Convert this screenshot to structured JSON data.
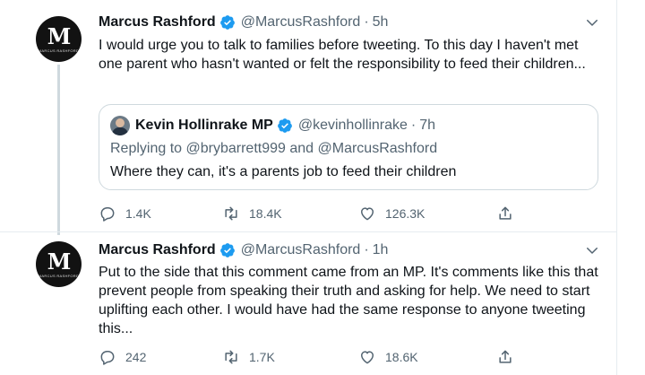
{
  "tweets": [
    {
      "author": {
        "name": "Marcus Rashford",
        "handle": "@MarcusRashford",
        "avatar_mark": "M",
        "avatar_caption": "MARCUS RASHFORD"
      },
      "time": "5h",
      "dot": "·",
      "text": "I would urge you to talk to families before tweeting. To this day I haven't met one parent who hasn't wanted or felt the responsibility to feed their children...",
      "quote": {
        "author": {
          "name": "Kevin Hollinrake MP",
          "handle": "@kevinhollinrake"
        },
        "time": "7h",
        "replying_label": "Replying to",
        "replying_to": "@brybarrett999 and @MarcusRashford",
        "text": "Where they can, it's a parents job to feed their children"
      },
      "stats": {
        "replies": "1.4K",
        "retweets": "18.4K",
        "likes": "126.3K"
      }
    },
    {
      "author": {
        "name": "Marcus Rashford",
        "handle": "@MarcusRashford",
        "avatar_mark": "M",
        "avatar_caption": "MARCUS RASHFORD"
      },
      "time": "1h",
      "dot": "·",
      "text": "Put to the side that this comment came from an MP. It's comments like this that prevent people from speaking their truth and asking for help. We need to start uplifting each other. I would have had the same response to anyone tweeting this...",
      "stats": {
        "replies": "242",
        "retweets": "1.7K",
        "likes": "18.6K"
      }
    }
  ],
  "icons": {
    "verified": "verified-badge-icon",
    "caret": "chevron-down-icon",
    "reply": "reply-icon",
    "retweet": "retweet-icon",
    "like": "heart-icon",
    "share": "share-icon"
  },
  "colors": {
    "verified": "#1d9bf0",
    "secondary_text": "#536471",
    "border": "#cfd9de"
  }
}
